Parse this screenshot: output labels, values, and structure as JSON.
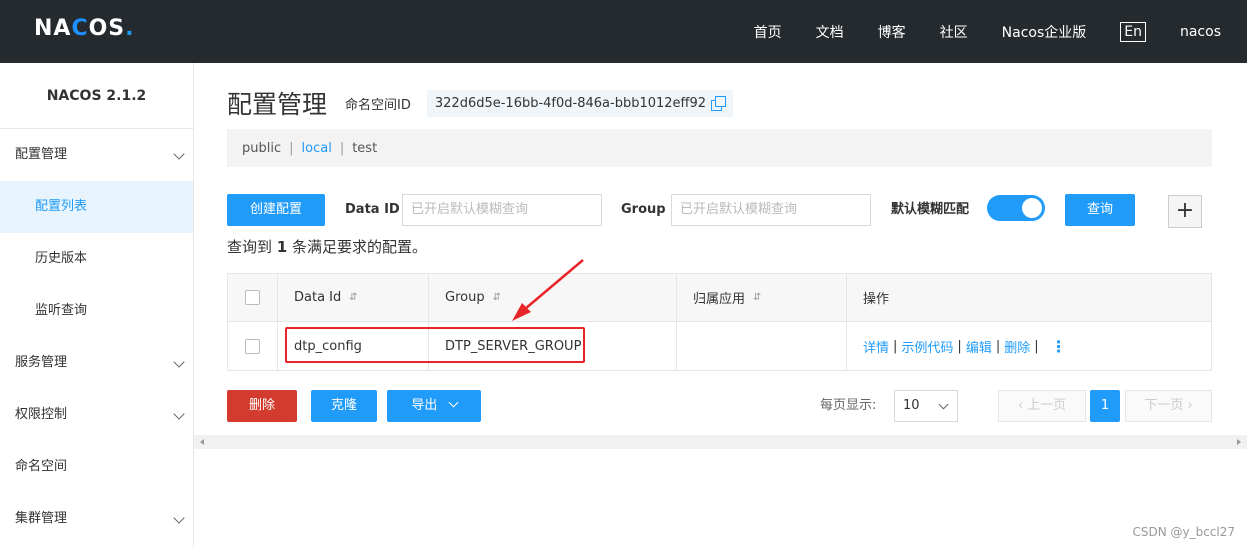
{
  "topbar": {
    "logo": "NACOS.",
    "nav": [
      "首页",
      "文档",
      "博客",
      "社区",
      "Nacos企业版"
    ],
    "lang": "En",
    "user": "nacos"
  },
  "sidebar": {
    "title": "NACOS 2.1.2",
    "items": [
      {
        "label": "配置管理",
        "expandable": true
      },
      {
        "label": "配置列表",
        "sub": true,
        "active": true
      },
      {
        "label": "历史版本",
        "sub": true
      },
      {
        "label": "监听查询",
        "sub": true
      },
      {
        "label": "服务管理",
        "expandable": true
      },
      {
        "label": "权限控制",
        "expandable": true
      },
      {
        "label": "命名空间"
      },
      {
        "label": "集群管理",
        "expandable": true
      }
    ]
  },
  "main": {
    "page_title": "配置管理",
    "ns_label": "命名空间ID",
    "ns_id": "322d6d5e-16bb-4f0d-846a-bbb1012eff92",
    "namespaces": [
      "public",
      "local",
      "test"
    ],
    "active_namespace": "local",
    "create_button": "创建配置",
    "dataid_label": "Data ID",
    "dataid_placeholder": "已开启默认模糊查询",
    "group_label": "Group",
    "group_placeholder": "已开启默认模糊查询",
    "fuzzy_label": "默认模糊匹配",
    "fuzzy_on": true,
    "query_button": "查询",
    "plus_button": "+",
    "result_prefix": "查询到",
    "result_count": "1",
    "result_suffix": "条满足要求的配置。"
  },
  "table": {
    "headers": [
      "Data Id",
      "Group",
      "归属应用",
      "操作"
    ],
    "rows": [
      {
        "data_id": "dtp_config",
        "group": "DTP_SERVER_GROUP",
        "app": ""
      }
    ],
    "ops": [
      "详情",
      "示例代码",
      "编辑",
      "删除"
    ]
  },
  "actions": {
    "delete": "删除",
    "clone": "克隆",
    "export": "导出"
  },
  "pagination": {
    "page_size_label": "每页显示:",
    "page_size": "10",
    "prev": "上一页",
    "current": "1",
    "next": "下一页"
  },
  "watermark": "CSDN @y_bccl27",
  "colors": {
    "topbar": "#252a2f",
    "primary": "#209bfa",
    "danger": "#d23b2d",
    "annotation": "#e8262a"
  }
}
